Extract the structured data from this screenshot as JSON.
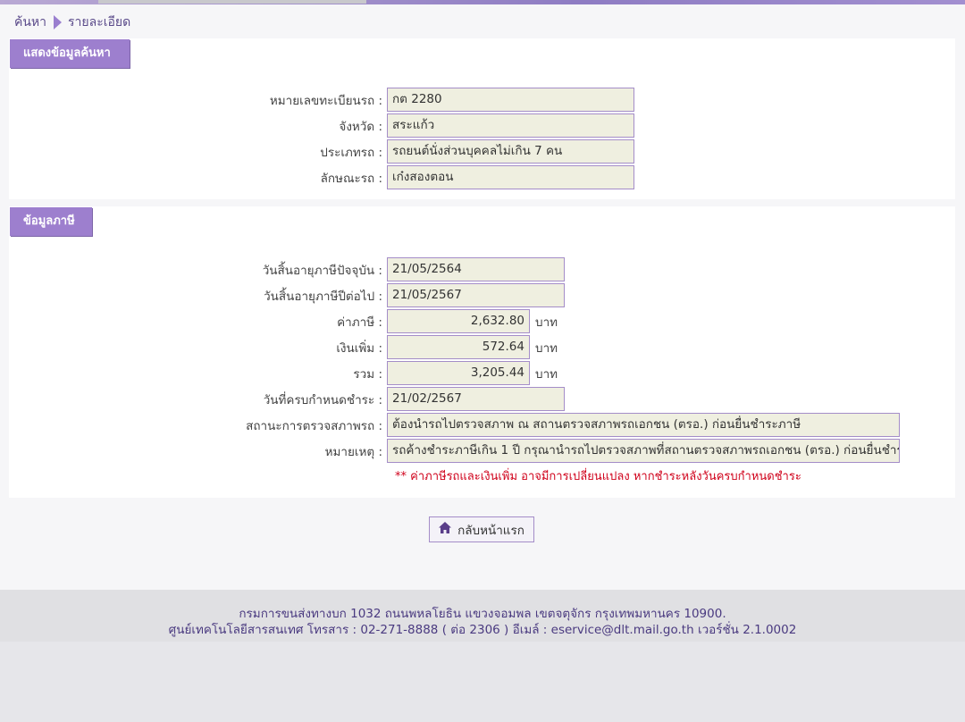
{
  "breadcrumb": {
    "home": "ค้นหา",
    "current": "รายละเอียด"
  },
  "search_section": {
    "title": "แสดงข้อมูลค้นหา",
    "fields": [
      {
        "label": "หมายเลขทะเบียนรถ :",
        "value": "กต 2280"
      },
      {
        "label": "จังหวัด :",
        "value": "สระแก้ว"
      },
      {
        "label": "ประเภทรถ :",
        "value": "รถยนต์นั่งส่วนบุคคลไม่เกิน 7 คน"
      },
      {
        "label": "ลักษณะรถ :",
        "value": "เก๋งสองตอน"
      }
    ]
  },
  "tax_section": {
    "title": "ข้อมูลภาษี",
    "current_expiry": {
      "label": "วันสิ้นอายุภาษีปัจจุบัน :",
      "value": "21/05/2564"
    },
    "next_expiry": {
      "label": "วันสิ้นอายุภาษีปีต่อไป :",
      "value": "21/05/2567"
    },
    "tax": {
      "label": "ค่าภาษี :",
      "value": "2,632.80",
      "unit": "บาท"
    },
    "surcharge": {
      "label": "เงินเพิ่ม :",
      "value": "572.64",
      "unit": "บาท"
    },
    "total": {
      "label": "รวม :",
      "value": "3,205.44",
      "unit": "บาท"
    },
    "due_date": {
      "label": "วันที่ครบกำหนดชำระ :",
      "value": "21/02/2567"
    },
    "inspection_status": {
      "label": "สถานะการตรวจสภาพรถ :",
      "value": "ต้องนำรถไปตรวจสภาพ ณ สถานตรวจสภาพรถเอกชน (ตรอ.) ก่อนยื่นชำระภาษี"
    },
    "remark": {
      "label": "หมายเหตุ :",
      "value": "รถค้างชำระภาษีเกิน 1 ปี กรุณานำรถไปตรวจสภาพที่สถานตรวจสภาพรถเอกชน (ตรอ.) ก่อนยื่นชำระ"
    },
    "warning": "** ค่าภาษีรถและเงินเพิ่ม อาจมีการเปลี่ยนแปลง หากชำระหลังวันครบกำหนดชำระ"
  },
  "back_button": {
    "label": "กลับหน้าแรก",
    "icon": "home-icon"
  },
  "footer": {
    "line1": "กรมการขนส่งทางบก 1032 ถนนพหลโยธิน แขวงจอมพล เขตจตุจักร กรุงเทพมหานคร 10900.",
    "line2": "ศูนย์เทคโนโลยีสารสนเทศ โทรสาร : 02-271-8888 ( ต่อ 2306 ) อีเมล์ : eservice@dlt.mail.go.th เวอร์ชั่น 2.1.0002"
  },
  "colors": {
    "accent": "#9d7fce",
    "field_bg": "#efefe0",
    "warning": "#d0021b",
    "footer_text": "#4a3a80"
  }
}
